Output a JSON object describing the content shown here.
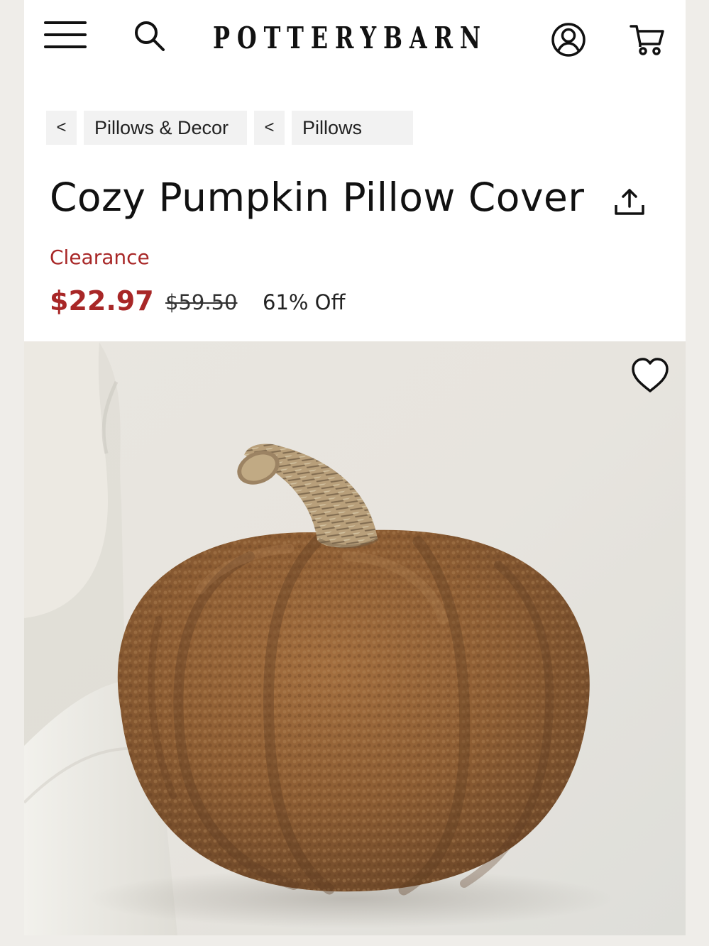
{
  "brand": {
    "name": "POTTERYBARN"
  },
  "header": {
    "menu_icon": "hamburger-menu-icon",
    "search_icon": "search-icon",
    "account_icon": "account-icon",
    "cart_icon": "shopping-cart-icon"
  },
  "breadcrumb": {
    "back_symbol": "<",
    "items": [
      {
        "label": "Pillows & Decor"
      },
      {
        "label": "Pillows"
      }
    ]
  },
  "product": {
    "title": "Cozy Pumpkin Pillow Cover",
    "status": "Clearance",
    "sale_price": "$22.97",
    "original_price": "$59.50",
    "discount": "61% Off",
    "share_icon": "share-icon",
    "favorite_icon": "heart-icon"
  },
  "colors": {
    "sale_red": "#a82727",
    "text": "#111111",
    "page_background": "#efede9"
  }
}
